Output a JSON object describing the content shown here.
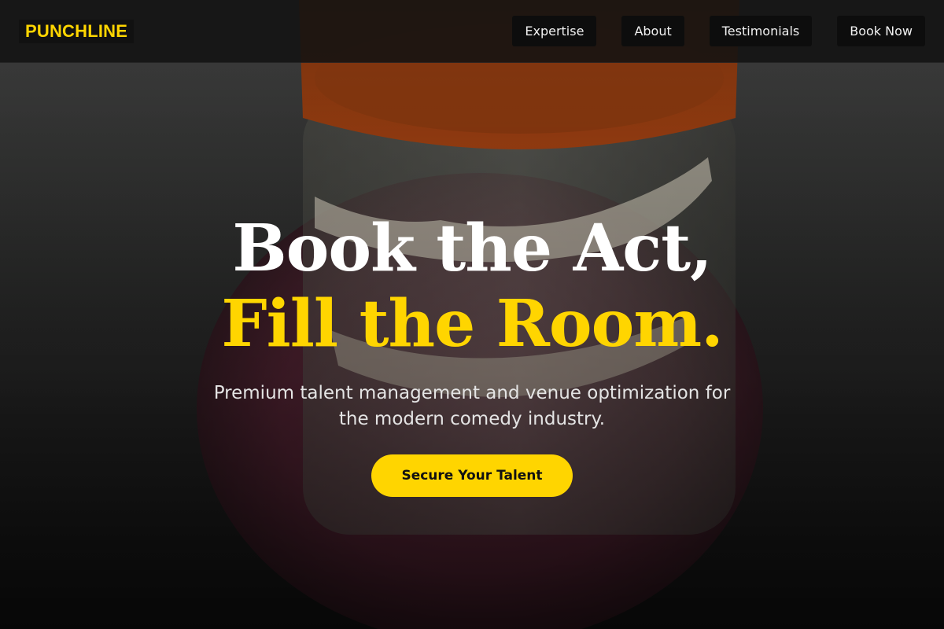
{
  "brand": {
    "logo_text": "PUNCHLINE",
    "accent_color": "#ffd500"
  },
  "nav": {
    "items": [
      {
        "label": "Expertise"
      },
      {
        "label": "About"
      },
      {
        "label": "Testimonials"
      },
      {
        "label": "Book Now"
      }
    ]
  },
  "hero": {
    "headline_line1": "Book the Act,",
    "headline_line2": "Fill the Room.",
    "subtitle": "Premium talent management and venue optimization for the modern comedy industry.",
    "cta_label": "Secure Your Talent",
    "background_image": "wind-up-chattering-teeth-photo"
  }
}
